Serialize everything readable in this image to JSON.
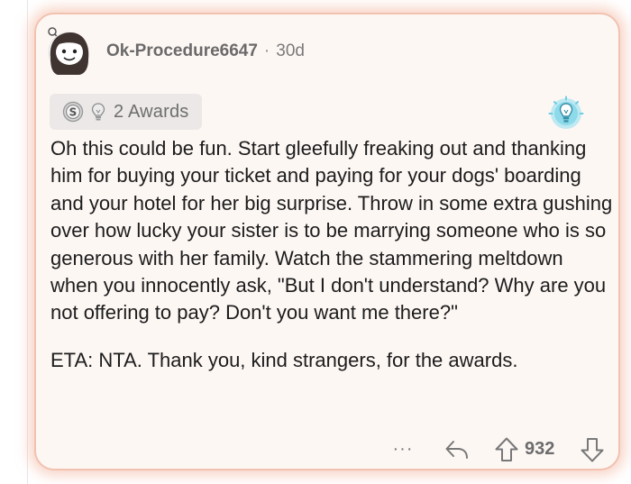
{
  "comment": {
    "author": "Ok-Procedure6647",
    "separator": "·",
    "age": "30d",
    "awards_label": "2 Awards",
    "paragraphs": [
      "Oh this could be fun. Start gleefully freaking out and thanking him for buying your ticket and paying for your dogs' boarding and your hotel for her big surprise. Throw in some extra gushing over how lucky your sister is to be marrying someone who is so generous with her family. Watch the stammering meltdown when you innocently ask,  \"But I don't understand? Why are you not offering to pay? Don't you want me there?\"",
      "ETA: NTA. Thank you,  kind strangers, for the awards."
    ]
  },
  "actions": {
    "more_label": "···",
    "vote_count": "932"
  },
  "icons": {
    "avatar": "snoo-avatar-icon",
    "award_silver": "silver-award-icon",
    "award_helpful": "helpful-lightbulb-icon",
    "flair": "lightbulb-flair-icon",
    "reply": "reply-arrow-icon",
    "upvote": "upvote-arrow-icon",
    "downvote": "downvote-arrow-icon"
  },
  "colors": {
    "card_background": "#fdf7f4",
    "card_glow": "#f3b49c",
    "text": "#1c1c1c",
    "muted": "#6d6d6d",
    "award_pill": "#ebe8e7",
    "flair_blue": "#6fcde3"
  }
}
